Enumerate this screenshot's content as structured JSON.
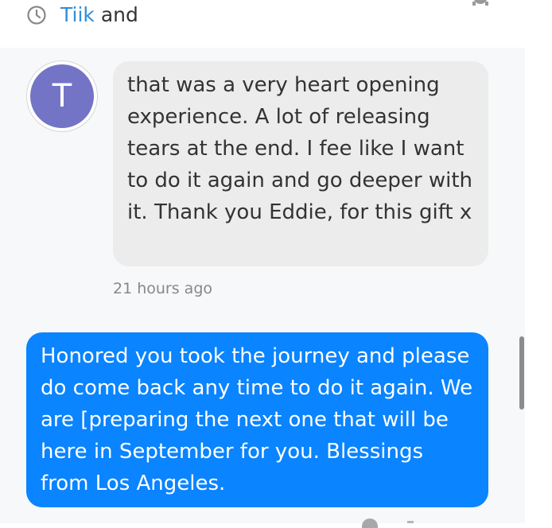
{
  "header": {
    "name": "Tiik",
    "suffix": " and"
  },
  "icons": {
    "clock": "clock-icon",
    "gear": "gear-icon"
  },
  "messages": [
    {
      "sender_initial": "T",
      "text": "that was a very heart opening experience. A lot of releasing tears at the end. I fee like I want to do it again and go deeper with it. Thank you Eddie, for this gift x",
      "timestamp": "21 hours ago"
    },
    {
      "text": "Honored you took the journey and please do come back any time to do it again. We are [preparing the next one that will be here in September for you. Blessings from Los Angeles."
    }
  ],
  "colors": {
    "outgoing_bubble": "#0a84ff",
    "incoming_bubble": "#ececec",
    "avatar": "#7474c6",
    "header_name": "#2f8fd6"
  }
}
